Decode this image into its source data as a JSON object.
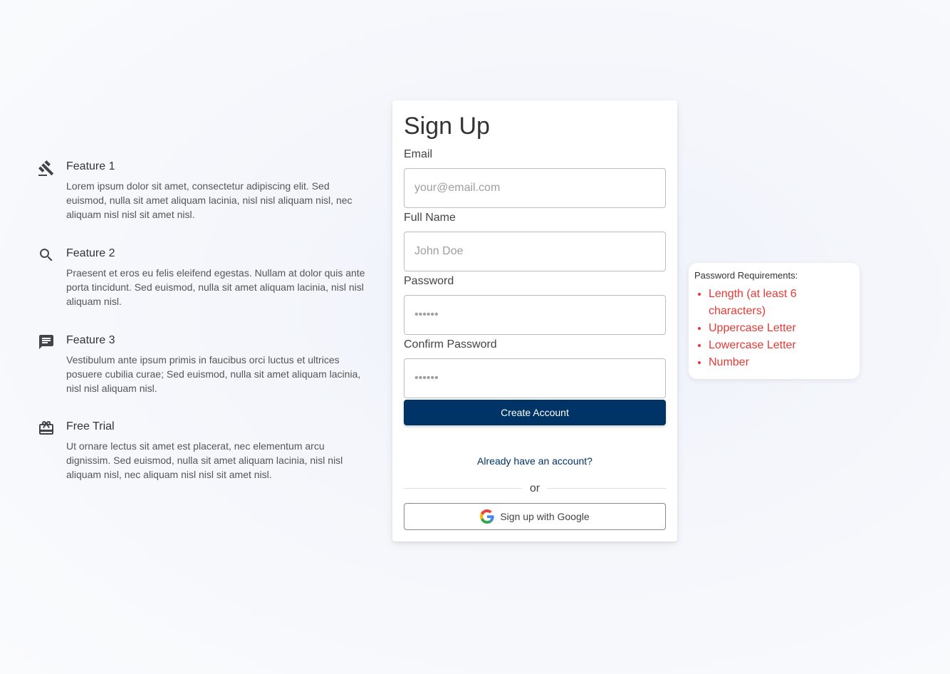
{
  "features": [
    {
      "icon": "gavel-icon",
      "title": "Feature 1",
      "desc": "Lorem ipsum dolor sit amet, consectetur adipiscing elit. Sed euismod, nulla sit amet aliquam lacinia, nisl nisl aliquam nisl, nec aliquam nisl nisl sit amet nisl."
    },
    {
      "icon": "search-icon",
      "title": "Feature 2",
      "desc": "Praesent et eros eu felis eleifend egestas. Nullam at dolor quis ante porta tincidunt. Sed euismod, nulla sit amet aliquam lacinia, nisl nisl aliquam nisl."
    },
    {
      "icon": "comment-icon",
      "title": "Feature 3",
      "desc": "Vestibulum ante ipsum primis in faucibus orci luctus et ultrices posuere cubilia curae; Sed euismod, nulla sit amet aliquam lacinia, nisl nisl aliquam nisl."
    },
    {
      "icon": "gift-card-icon",
      "title": "Free Trial",
      "desc": "Ut ornare lectus sit amet est placerat, nec elementum arcu dignissim. Sed euismod, nulla sit amet aliquam lacinia, nisl nisl aliquam nisl, nec aliquam nisl nisl sit amet nisl."
    }
  ],
  "form": {
    "title": "Sign Up",
    "email_label": "Email",
    "email_placeholder": "your@email.com",
    "name_label": "Full Name",
    "name_placeholder": "John Doe",
    "password_label": "Password",
    "password_placeholder": "••••••",
    "confirm_label": "Confirm Password",
    "confirm_placeholder": "••••••",
    "submit_label": "Create Account",
    "signin_link": "Already have an account?",
    "divider_text": "or",
    "google_label": "Sign up with Google"
  },
  "password_requirements": {
    "title": "Password Requirements:",
    "items": [
      "Length (at least 6 characters)",
      "Uppercase Letter",
      "Lowercase Letter",
      "Number"
    ],
    "status_color": "#e53935"
  },
  "colors": {
    "primary": "#003366",
    "text": "#333333"
  }
}
